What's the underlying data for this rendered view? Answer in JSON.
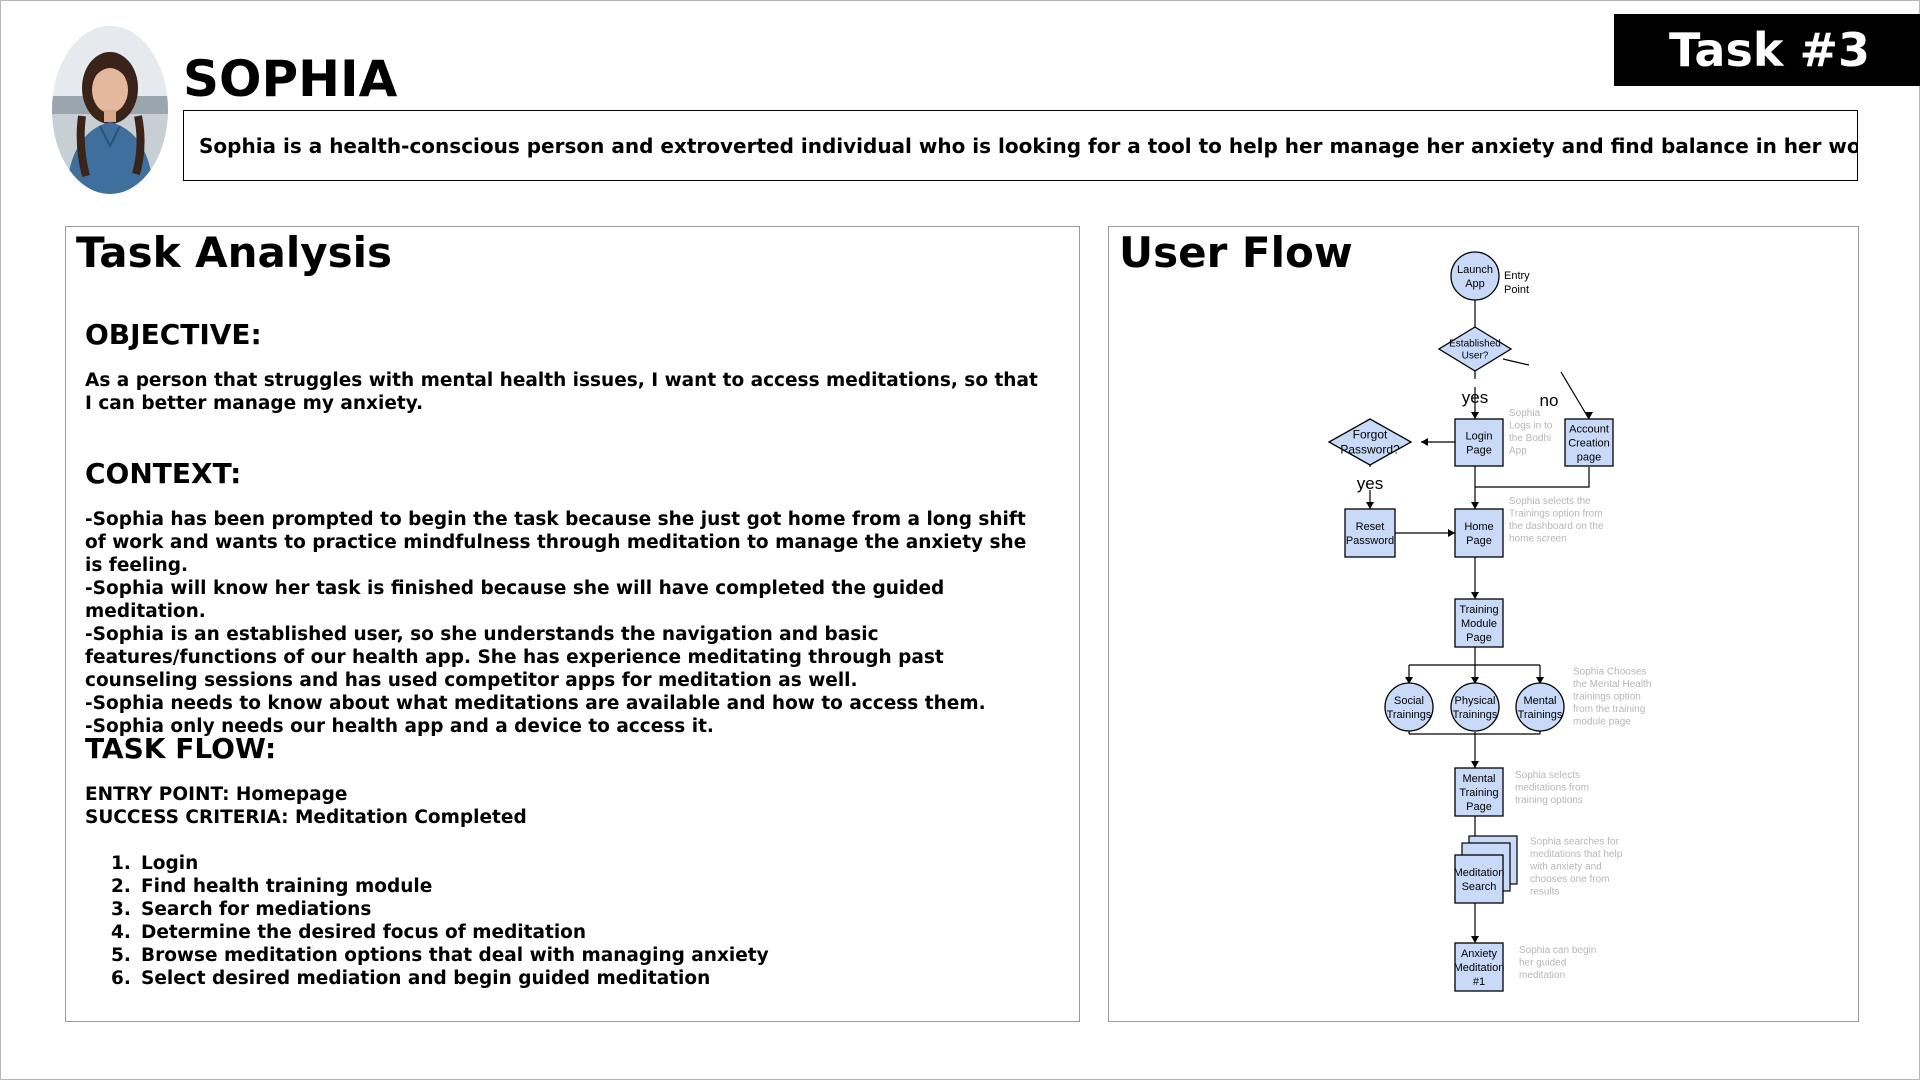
{
  "header": {
    "persona_name": "SOPHIA",
    "task_badge": "Task #3",
    "persona_description": "Sophia is a health-conscious person and extroverted individual who is looking for a tool to help her manage her anxiety and find balance in her work-life schedule."
  },
  "task_analysis": {
    "title": "Task Analysis",
    "objective_heading": "OBJECTIVE:",
    "objective_text": "As a person that struggles with mental health issues, I want to access meditations, so that I can better manage my anxiety.",
    "context_heading": "CONTEXT:",
    "context_lines": [
      "-Sophia has been prompted to begin the task because she just got home from a long shift of work and wants to practice mindfulness through meditation to manage the anxiety she is feeling.",
      "-Sophia will know her task is finished because she will have completed the guided meditation.",
      "-Sophia is an established user, so she understands the navigation and basic features/functions of our health app. She has experience meditating through past counseling sessions  and has used competitor apps for meditation as well.",
      "-Sophia needs to know about what meditations are available and how to access them.",
      "-Sophia only needs our health app and a device to access it."
    ],
    "task_flow_heading": "TASK FLOW:",
    "entry_point": "ENTRY POINT: Homepage",
    "success_criteria": "SUCCESS CRITERIA: Meditation Completed",
    "steps": [
      {
        "num": "1.",
        "text": "Login"
      },
      {
        "num": "2.",
        "text": "Find health training module"
      },
      {
        "num": "3.",
        "text": "Search for mediations"
      },
      {
        "num": "4.",
        "text": "Determine the desired focus of meditation"
      },
      {
        "num": "5.",
        "text": "Browse meditation options that deal with managing anxiety"
      },
      {
        "num": "6.",
        "text": "Select desired mediation and begin guided meditation"
      }
    ]
  },
  "user_flow": {
    "title": "User Flow",
    "colors": {
      "node_fill": "#c9daf8",
      "node_stroke": "#000000",
      "note_text": "#b7b7b7"
    },
    "nodes": {
      "launch": [
        "Launch",
        "App"
      ],
      "entry_label": [
        "Entry",
        "Point"
      ],
      "established": [
        "Established",
        "User?"
      ],
      "yes_label": "yes",
      "no_label": "no",
      "login": [
        "Login",
        "Page"
      ],
      "account": [
        "Account",
        "Creation",
        "page"
      ],
      "forgot": [
        "Forgot",
        "Password?"
      ],
      "forgot_yes": "yes",
      "reset": [
        "Reset",
        "Password"
      ],
      "home": [
        "Home",
        "Page"
      ],
      "training_module": [
        "Training",
        "Module",
        "Page"
      ],
      "social": [
        "Social",
        "Trainings"
      ],
      "physical": [
        "Physical",
        "Trainings"
      ],
      "mental": [
        "Mental",
        "Trainings"
      ],
      "mental_page": [
        "Mental",
        "Training",
        "Page"
      ],
      "search": [
        "Meditation",
        "Search"
      ],
      "anxiety": [
        "Anxiety",
        "Meditation",
        "#1"
      ]
    },
    "notes": {
      "login": [
        "Sophia",
        "Logs in to",
        "the Bodhi",
        "App"
      ],
      "home": [
        "Sophia selects the",
        "Trainings option from",
        "the dashboard on the",
        "home screen"
      ],
      "trainings": [
        "Sophia Chooses",
        "the Mental Health",
        "trainings option",
        "from the training",
        "module page"
      ],
      "mental_page": [
        "Sophia selects",
        "meditations from",
        "training options"
      ],
      "search": [
        "Sophia searches for",
        "meditations that help",
        "with anxiety and",
        "chooses one from",
        "results"
      ],
      "anxiety": [
        "Sophia can  begin",
        "her guided",
        "meditation"
      ]
    }
  }
}
